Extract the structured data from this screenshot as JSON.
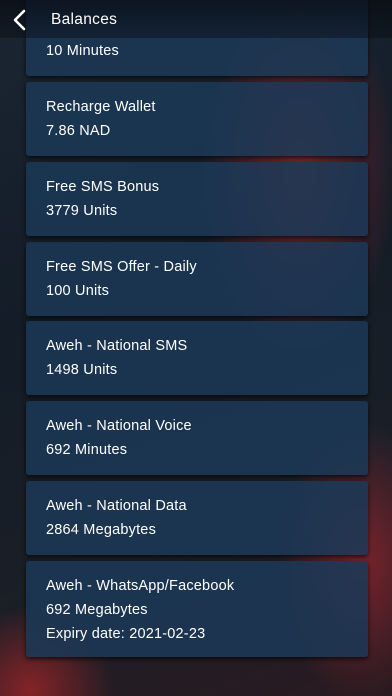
{
  "header": {
    "title": "Balances",
    "back_icon": "chevron-left-icon"
  },
  "balances": [
    {
      "name": "",
      "value": "10 Minutes"
    },
    {
      "name": "Recharge Wallet",
      "value": "7.86 NAD"
    },
    {
      "name": "Free SMS Bonus",
      "value": "3779 Units"
    },
    {
      "name": "Free SMS Offer - Daily",
      "value": "100 Units"
    },
    {
      "name": "Aweh - National SMS",
      "value": "1498 Units"
    },
    {
      "name": "Aweh - National Voice",
      "value": "692 Minutes"
    },
    {
      "name": "Aweh - National Data",
      "value": "2864 Megabytes"
    },
    {
      "name": "Aweh - WhatsApp/Facebook",
      "value": "692 Megabytes",
      "expiry": "Expiry date: 2021-02-23"
    }
  ]
}
